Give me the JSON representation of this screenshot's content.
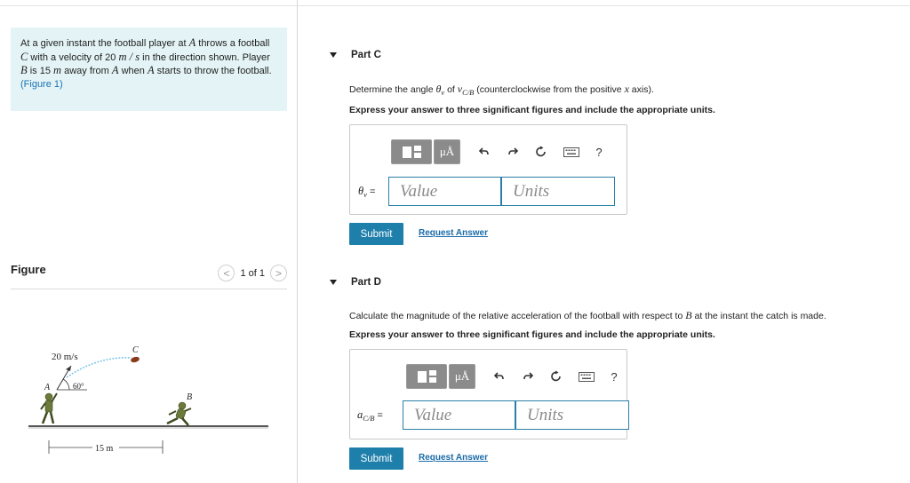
{
  "problem": {
    "segments": [
      {
        "t": "At a given instant the football player at "
      },
      {
        "t": "A",
        "m": true
      },
      {
        "t": " throws a football "
      },
      {
        "t": "C",
        "m": true
      },
      {
        "t": " with a velocity of 20 "
      },
      {
        "t": "m / s",
        "m": true
      },
      {
        "t": " in the direction shown. Player "
      },
      {
        "t": "B",
        "m": true
      },
      {
        "t": " is 15 "
      },
      {
        "t": "m",
        "m": true
      },
      {
        "t": " away from "
      },
      {
        "t": "A",
        "m": true
      },
      {
        "t": " when "
      },
      {
        "t": "A",
        "m": true
      },
      {
        "t": " starts to throw the football."
      }
    ],
    "figure_link": "(Figure 1)"
  },
  "figure_panel": {
    "title": "Figure",
    "pager_prev": "<",
    "pager_text": "1 of 1",
    "pager_next": ">",
    "labels": {
      "velocity": "20 m/s",
      "angle": "60°",
      "point_a": "A",
      "point_b": "B",
      "point_c": "C",
      "distance": "15 m"
    }
  },
  "parts": [
    {
      "title": "Part C",
      "question": [
        {
          "t": "Determine the angle "
        },
        {
          "t": "θ",
          "m": true
        },
        {
          "t": "v",
          "sub": true
        },
        {
          "t": " of "
        },
        {
          "t": "v",
          "m": true
        },
        {
          "t": "C/B",
          "sub": true
        },
        {
          "t": " (counterclockwise from the positive "
        },
        {
          "t": "x",
          "m": true
        },
        {
          "t": " axis)."
        }
      ],
      "instruction": "Express your answer to three significant figures and include the appropriate units.",
      "label": [
        {
          "t": "θ",
          "m": true
        },
        {
          "t": "v",
          "sub": true
        },
        {
          "t": " ="
        }
      ],
      "value_placeholder": "Value",
      "units_placeholder": "Units",
      "mu_label": "μÅ",
      "help_label": "?",
      "submit_label": "Submit",
      "request_label": "Request Answer"
    },
    {
      "title": "Part D",
      "question": [
        {
          "t": "Calculate the magnitude of the relative acceleration of the football with respect to "
        },
        {
          "t": "B",
          "m": true
        },
        {
          "t": " at the instant the catch is made."
        }
      ],
      "instruction": "Express your answer to three significant figures and include the appropriate units.",
      "label": [
        {
          "t": "a",
          "m": true
        },
        {
          "t": "C/B",
          "sub": true
        },
        {
          "t": " ="
        }
      ],
      "value_placeholder": "Value",
      "units_placeholder": "Units",
      "mu_label": "μÅ",
      "help_label": "?",
      "submit_label": "Submit",
      "request_label": "Request Answer"
    }
  ],
  "icons": [
    "template-icon",
    "undo-icon",
    "redo-icon",
    "reset-icon",
    "keyboard-icon",
    "help-icon"
  ],
  "colors": {
    "problem_bg": "#e4f4f6",
    "accent": "#1f7fab",
    "link": "#1a72b5",
    "input_border": "#2a7fa8",
    "tool_button": "#8b8b8b"
  }
}
